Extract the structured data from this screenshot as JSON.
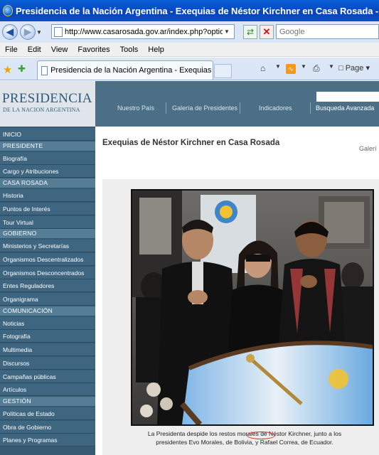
{
  "window": {
    "title": "Presidencia de la Nación Argentina - Exequias de Néstor Kirchner en Casa Rosada - Windows Int..."
  },
  "browser": {
    "url": "http://www.casarosada.gov.ar/index.php?option=com_rs",
    "search_placeholder": "Google",
    "menu": [
      "File",
      "Edit",
      "View",
      "Favorites",
      "Tools",
      "Help"
    ],
    "tab_title": "Presidencia de la Nación Argentina - Exequias de Néstor ...",
    "page_menu": "Page"
  },
  "site": {
    "logo_main": "PRESIDENCIA",
    "logo_sub": "DE LA NACION ARGENTINA",
    "nav": [
      "Nuestro País",
      "Galería de Presidentes",
      "Indicadores",
      "Busqueda Avanzada"
    ]
  },
  "sidebar": {
    "items": [
      {
        "type": "item",
        "label": "INICIO"
      },
      {
        "type": "section",
        "label": "PRESIDENTE"
      },
      {
        "type": "item",
        "label": "Biografía"
      },
      {
        "type": "item",
        "label": "Cargo y Atribuciones"
      },
      {
        "type": "section",
        "label": "CASA ROSADA"
      },
      {
        "type": "item",
        "label": "Historia"
      },
      {
        "type": "item",
        "label": "Puntos de Interés"
      },
      {
        "type": "item",
        "label": "Tour Virtual"
      },
      {
        "type": "section",
        "label": "GOBIERNO"
      },
      {
        "type": "item",
        "label": "Ministerios y Secretarías"
      },
      {
        "type": "item",
        "label": "Organismos Descentralizados"
      },
      {
        "type": "item",
        "label": "Organismos Desconcentrados"
      },
      {
        "type": "item",
        "label": "Entes Reguladores"
      },
      {
        "type": "item",
        "label": "Organigrama"
      },
      {
        "type": "section",
        "label": "COMUNICACIÓN"
      },
      {
        "type": "item",
        "label": "Noticias"
      },
      {
        "type": "item",
        "label": "Fotografía"
      },
      {
        "type": "item",
        "label": "Multimedia"
      },
      {
        "type": "item",
        "label": "Discursos"
      },
      {
        "type": "item",
        "label": "Campañas públicas"
      },
      {
        "type": "item",
        "label": "Artículos"
      },
      {
        "type": "section",
        "label": "GESTIÓN"
      },
      {
        "type": "item",
        "label": "Políticas de Estado"
      },
      {
        "type": "item",
        "label": "Obra de Gobierno"
      },
      {
        "type": "item",
        "label": "Planes y Programas"
      }
    ]
  },
  "article": {
    "title": "Exequias de Néstor Kirchner en Casa Rosada",
    "breadcrumb_cut": "Galerí",
    "caption_line1": "La Presidenta despide los restos morales de Néstor Kirchner, junto a los",
    "caption_line2": "presidentes Evo Morales, de Bolivia, y Rafael Correa, de Ecuador."
  }
}
